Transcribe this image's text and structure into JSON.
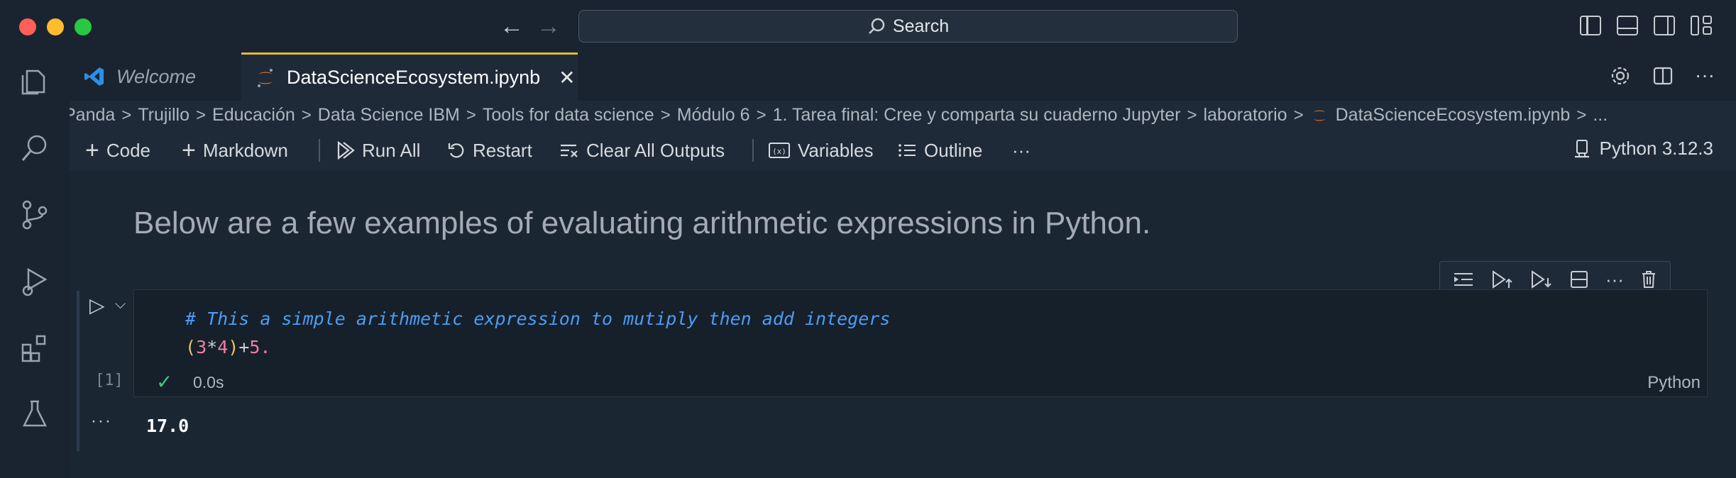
{
  "window": {
    "search_label": "Search"
  },
  "tabs": [
    {
      "label": "Welcome"
    },
    {
      "label": "DataScienceEcosystem.ipynb"
    }
  ],
  "breadcrumb": [
    "Panda",
    "Trujillo",
    "Educación",
    "Data Science IBM",
    "Tools for data science",
    "Módulo 6",
    "1. Tarea final: Cree y comparta su cuaderno Jupyter",
    "laboratorio",
    "DataScienceEcosystem.ipynb",
    "..."
  ],
  "toolbar": {
    "code": "Code",
    "markdown": "Markdown",
    "run_all": "Run All",
    "restart": "Restart",
    "clear_outputs": "Clear All Outputs",
    "variables": "Variables",
    "outline": "Outline",
    "more": "···",
    "kernel": "Python 3.12.3"
  },
  "notebook": {
    "markdown_text": "Below are a few examples of evaluating arithmetic expressions in Python.",
    "cell": {
      "comment": "# This a simple arithmetic expression to mutiply then add integers",
      "tok1": "(",
      "tok2": "3",
      "tok3": "*",
      "tok4": "4",
      "tok5": ")",
      "tok6": "+",
      "tok7": "5.",
      "exec_count": "[1]",
      "exec_time": "0.0s",
      "language": "Python",
      "output": "17.0"
    }
  },
  "colors": {
    "accent_tab": "#e2b93d",
    "success": "#4cbf7f",
    "comment": "#4d9cf4"
  }
}
